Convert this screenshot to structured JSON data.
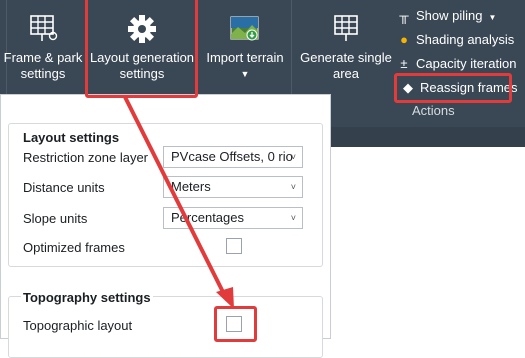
{
  "ribbon": {
    "frame_park_settings": "Frame & park\nsettings",
    "layout_generation_settings": "Layout generation\nsettings",
    "import_terrain": "Import terrain",
    "generate_single_area": "Generate single\narea",
    "actions_group_label": "Actions",
    "small_buttons": [
      {
        "label": "Show piling",
        "icon": "piling-icon"
      },
      {
        "label": "Shading analysis",
        "icon": "sun-icon"
      },
      {
        "label": "Capacity iteration",
        "icon": "plus-minus-icon"
      },
      {
        "label": "Reassign frames",
        "icon": "reassign-icon"
      }
    ]
  },
  "layout_settings": {
    "title": "Layout settings",
    "restriction_zone_label": "Restriction zone layer",
    "restriction_zone_value": "PVcase Offsets, 0 rio",
    "distance_units_label": "Distance units",
    "distance_units_value": "Meters",
    "slope_units_label": "Slope units",
    "slope_units_value": "Percentages",
    "optimized_frames_label": "Optimized frames",
    "optimized_frames_checked": false
  },
  "topography_settings": {
    "title": "Topography settings",
    "topographic_layout_label": "Topographic layout",
    "topographic_layout_checked": false
  },
  "colors": {
    "ribbon_bg": "#3a4754",
    "highlight": "#e23b3b"
  }
}
